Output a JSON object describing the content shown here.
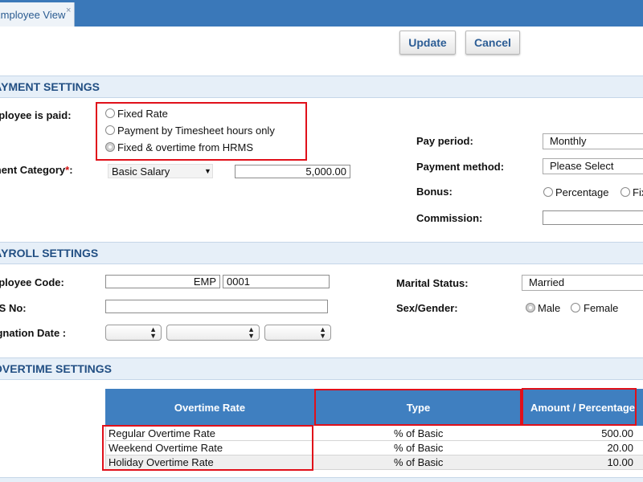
{
  "tab": {
    "label": "Employee View",
    "close_glyph": "×"
  },
  "toolbar": {
    "update_label": "Update",
    "cancel_label": "Cancel"
  },
  "payment": {
    "section_title": "PAYMENT SETTINGS",
    "paid_label": "Employee is paid:",
    "options": [
      {
        "label": "Fixed Rate",
        "selected": false
      },
      {
        "label": "Payment by Timesheet hours only",
        "selected": false
      },
      {
        "label": "Fixed & overtime from HRMS",
        "selected": true
      }
    ],
    "category_label": "Payment Category",
    "required_mark": "*",
    "category_colon": ":",
    "category_value": "Basic Salary",
    "amount_value": "5,000.00",
    "pay_period_label": "Pay period:",
    "pay_period_value": "Monthly",
    "method_label": "Payment method:",
    "method_value": "Please Select",
    "bonus_label": "Bonus:",
    "bonus_options": [
      "Percentage",
      "Fixed"
    ],
    "commission_label": "Commission:",
    "commission_value": ""
  },
  "payroll": {
    "section_title": "PAYROLL SETTINGS",
    "code_label": "Employee Code:",
    "code_prefix": "EMP",
    "code_number": "0001",
    "ss_label": "SS No:",
    "ss_value": "",
    "resign_label": "Resignation Date :",
    "marital_label": "Marital Status:",
    "marital_value": "Married",
    "gender_label": "Sex/Gender:",
    "gender_options": [
      {
        "label": "Male",
        "selected": true
      },
      {
        "label": "Female",
        "selected": false
      }
    ]
  },
  "overtime": {
    "section_title": "OVERTIME SETTINGS",
    "headers": [
      "Overtime Rate",
      "Type",
      "Amount / Percentage"
    ],
    "rows": [
      {
        "rate": "Regular Overtime Rate",
        "type": "% of Basic",
        "amount": "500.00"
      },
      {
        "rate": "Weekend Overtime Rate",
        "type": "% of Basic",
        "amount": "20.00"
      },
      {
        "rate": "Holiday Overtime Rate",
        "type": "% of Basic",
        "amount": "10.00"
      }
    ]
  },
  "colors": {
    "header_blue": "#3a78b9",
    "section_bg": "#e6eff8",
    "title_blue": "#224f83",
    "highlight_red": "#e0101a",
    "table_header": "#3f7fc0"
  }
}
